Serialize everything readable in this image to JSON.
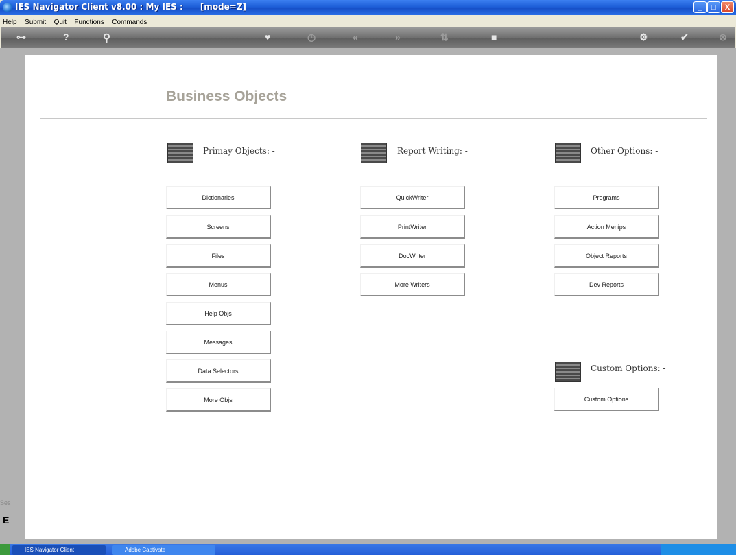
{
  "window": {
    "title": "IES Navigator Client v8.00 : My IES :      [mode=Z]",
    "minimize": "_",
    "maximize": "□",
    "close": "X"
  },
  "menu": [
    "Help",
    "Submit",
    "Quit",
    "Functions",
    "Commands"
  ],
  "toolbar_icons": [
    "key-icon",
    "help-icon",
    "search-icon",
    "heart-icon",
    "clock-icon",
    "back-icon",
    "forward-icon",
    "sort-icon",
    "stop-icon",
    "settings-icon",
    "check-icon",
    "close-icon"
  ],
  "page": {
    "heading": "Business Objects"
  },
  "sections": {
    "primary": {
      "title": "Primay Objects: -",
      "buttons": [
        "Dictionaries",
        "Screens",
        "Files",
        "Menus",
        "Help Objs",
        "Messages",
        "Data Selectors",
        "More Objs"
      ]
    },
    "report": {
      "title": "Report Writing: -",
      "buttons": [
        "QuickWriter",
        "PrintWriter",
        "DocWriter",
        "More Writers"
      ]
    },
    "other": {
      "title": "Other Options: -",
      "buttons": [
        "Programs",
        "Action Menips",
        "Object Reports",
        "Dev Reports"
      ]
    },
    "custom": {
      "title": "Custom Options: -",
      "buttons": [
        "Custom Options"
      ]
    }
  },
  "status": {
    "ses": "Ses",
    "indicator": "E"
  },
  "taskbar": {
    "items": [
      "IES Navigator Client",
      "Adobe Captivate"
    ]
  }
}
